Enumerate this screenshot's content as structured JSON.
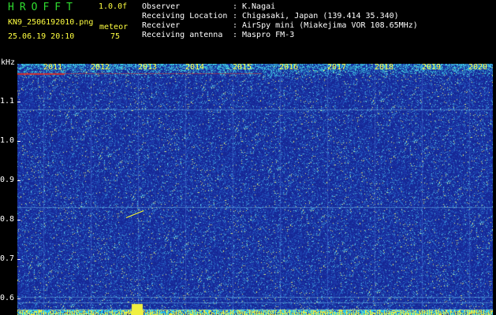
{
  "header": {
    "app_title": "HROFFT",
    "version": "1.0.0f",
    "filename": "KN9_2506192010.png",
    "datetime": "25.06.19 20:10",
    "mode_label": "meteor",
    "count": "75"
  },
  "info": [
    {
      "key": "Observer",
      "sep": ":",
      "value": "K.Nagai"
    },
    {
      "key": "Receiving Location",
      "sep": ":",
      "value": "Chigasaki, Japan (139.414 35.340)"
    },
    {
      "key": "Receiver",
      "sep": ":",
      "value": "AirSpy mini (Miakejima VOR 108.65MHz)"
    },
    {
      "key": "Receiving antenna",
      "sep": ":",
      "value": "Maspro FM-3"
    }
  ],
  "spectrogram": {
    "y_unit": "kHz",
    "y_ticks": [
      "1.1",
      "1.0",
      "0.9",
      "0.8",
      "0.7",
      "0.6"
    ],
    "x_labels": [
      "2011",
      "2012",
      "2013",
      "2014",
      "2015",
      "2016",
      "2017",
      "2018",
      "2019",
      "2020"
    ],
    "colors": {
      "background": "#1a2a9a",
      "carrier": "#d03030",
      "text_yellow": "#ffff40",
      "title_green": "#2fdc2f"
    }
  }
}
